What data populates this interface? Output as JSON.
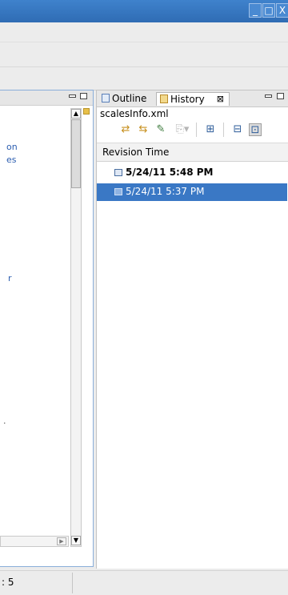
{
  "window": {
    "minimize": "_",
    "maximize": "□",
    "close": "X"
  },
  "editor": {
    "visible_text": [
      "on",
      "es",
      "r",
      "."
    ]
  },
  "views": {
    "tabs": [
      {
        "label": "Outline",
        "icon": "outline-icon",
        "active": false
      },
      {
        "label": "History",
        "icon": "history-icon",
        "active": true,
        "close": "⊠"
      }
    ],
    "min_glyph": "▭",
    "max_glyph": "□"
  },
  "history": {
    "file_name": "scalesInfo.xml",
    "column_header": "Revision Time",
    "rows": [
      {
        "time": "5/24/11 5:48 PM",
        "bold": true,
        "selected": false
      },
      {
        "time": "5/24/11 5:37 PM",
        "bold": false,
        "selected": true
      }
    ],
    "toolbar": [
      "refresh-icon",
      "link-icon",
      "pin-icon",
      "compare-dropdown-icon",
      "group-icon",
      "collapse-icon",
      "layout-icon"
    ]
  },
  "status": {
    "text": ": 5"
  },
  "colors": {
    "accent": "#3a78c5",
    "titlebar": "#2f6cb4",
    "link": "#2b5db0"
  }
}
